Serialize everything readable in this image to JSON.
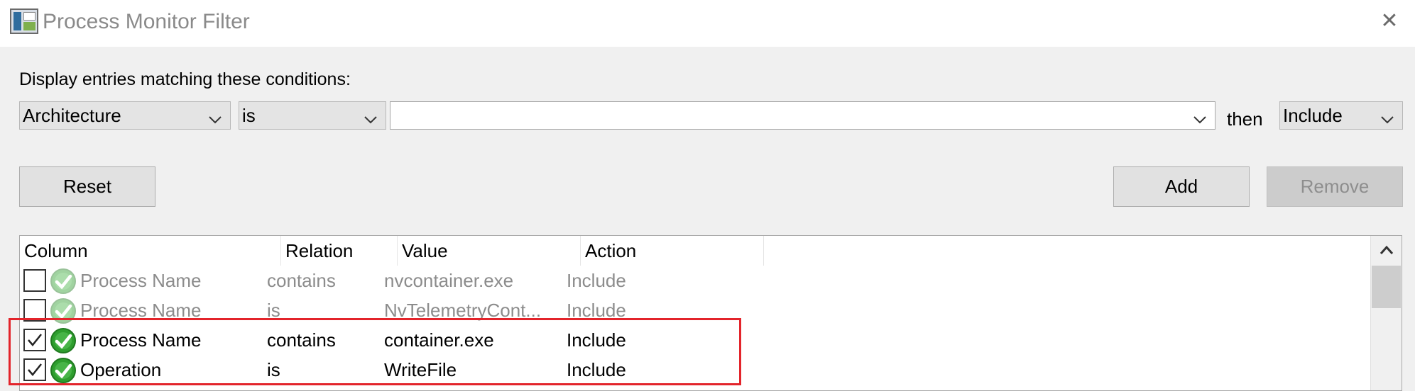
{
  "window": {
    "title": "Process Monitor Filter",
    "close_icon": "close-icon"
  },
  "prompt": "Display entries matching these conditions:",
  "condition": {
    "column": "Architecture",
    "relation": "is",
    "value": "",
    "then_label": "then",
    "action": "Include"
  },
  "buttons": {
    "reset": "Reset",
    "add": "Add",
    "remove": "Remove"
  },
  "list": {
    "headers": {
      "column": "Column",
      "relation": "Relation",
      "value": "Value",
      "action": "Action"
    },
    "rows": [
      {
        "checked": false,
        "column": "Process Name",
        "relation": "contains",
        "value": "nvcontainer.exe",
        "action": "Include"
      },
      {
        "checked": false,
        "column": "Process Name",
        "relation": "is",
        "value": "NvTelemetryCont...",
        "action": "Include"
      },
      {
        "checked": true,
        "column": "Process Name",
        "relation": "contains",
        "value": "container.exe",
        "action": "Include"
      },
      {
        "checked": true,
        "column": "Operation",
        "relation": "is",
        "value": "WriteFile",
        "action": "Include"
      }
    ]
  },
  "colors": {
    "highlight": "#e3242b",
    "ok_green": "#2e9e2e"
  }
}
